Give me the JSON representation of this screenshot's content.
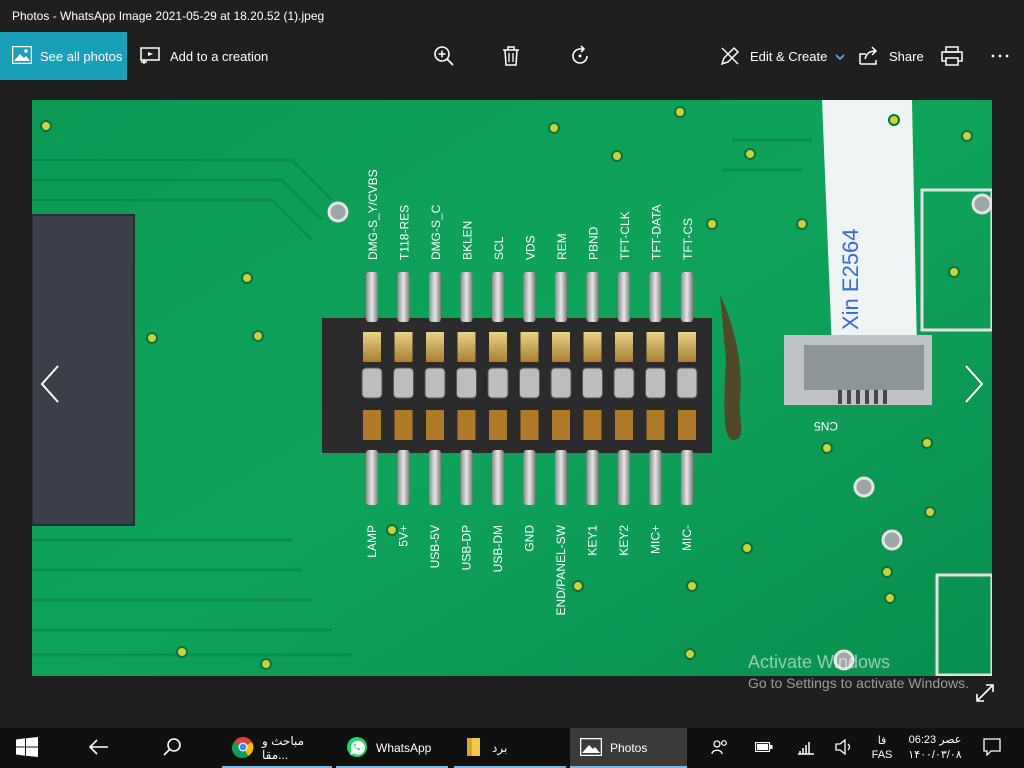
{
  "window": {
    "title": "Photos - WhatsApp Image 2021-05-29 at 18.20.52 (1).jpeg"
  },
  "toolbar": {
    "see_all_label": "See all photos",
    "add_creation_label": "Add to a creation",
    "edit_create_label": "Edit & Create",
    "share_label": "Share"
  },
  "photo": {
    "top_labels": [
      "DMG-S_Y/CVBS",
      "T118-RES",
      "DMG-S_C",
      "BKLEN",
      "SCL",
      "VDS",
      "REM",
      "PBND",
      "TFT-CLK",
      "TFT-DATA",
      "TFT-CS"
    ],
    "bottom_labels": [
      "LAMP",
      "5V+",
      "USB-5V",
      "USB-DP",
      "USB-DM",
      "GND",
      "END/PANEL-SW",
      "KEY1",
      "KEY2",
      "MIC+",
      "MIC-"
    ],
    "cable_text": "Xin  E2564",
    "connector_label": "CN5"
  },
  "watermark": {
    "line1": "Activate Windows",
    "line2": "Go to Settings to activate Windows."
  },
  "taskbar": {
    "apps": [
      {
        "label": "مباحث و مقا...",
        "icon": "chrome-icon"
      },
      {
        "label": "WhatsApp",
        "icon": "whatsapp-icon"
      },
      {
        "label": "برد",
        "icon": "folder-icon"
      },
      {
        "label": "Photos",
        "icon": "photos-icon"
      }
    ],
    "clock_time": "06:23 عصر",
    "clock_date": "۱۴۰۰/۰۳/۰۸",
    "lang_top": "فا",
    "lang_bottom": "FAS"
  }
}
